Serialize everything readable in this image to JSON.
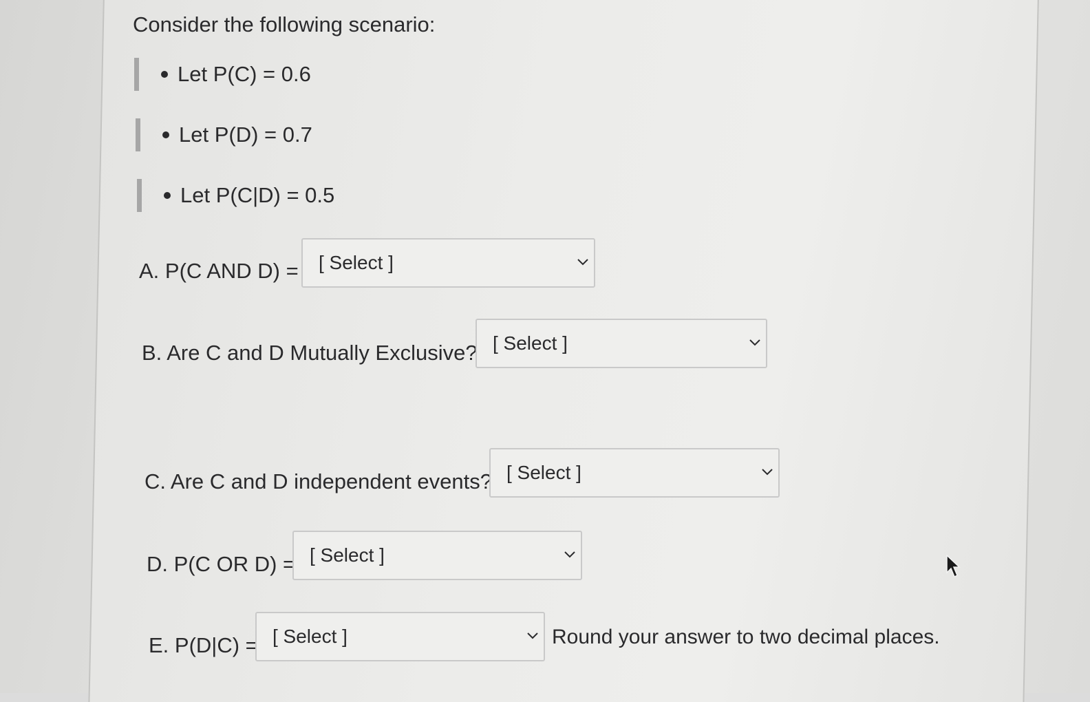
{
  "prompt": {
    "heading": "Consider the following scenario:"
  },
  "given": [
    {
      "text": "Let P(C) = 0.6"
    },
    {
      "text": "Let P(D) = 0.7"
    },
    {
      "text": "Let P(C|D) = 0.5"
    }
  ],
  "questions": [
    {
      "id": "A",
      "label": "A. P(C AND D) =",
      "selected": "[ Select ]"
    },
    {
      "id": "B",
      "label": "B. Are C and D Mutually Exclusive?",
      "selected": "[ Select ]"
    },
    {
      "id": "C",
      "label": "C. Are C and D independent events?",
      "selected": "[ Select ]"
    },
    {
      "id": "D",
      "label": "D. P(C OR D) =",
      "selected": "[ Select ]"
    },
    {
      "id": "E",
      "label": "E. P(D|C) =",
      "selected": "[ Select ]"
    }
  ],
  "note": "Round your answer to two decimal places.",
  "icons": {
    "dropdown": "chevron-down-icon",
    "pointer": "mouse-pointer-icon"
  },
  "colors": {
    "text": "#2a2a2c",
    "select_border": "#c9c9c9",
    "marker_bar": "#a6a6a6"
  }
}
